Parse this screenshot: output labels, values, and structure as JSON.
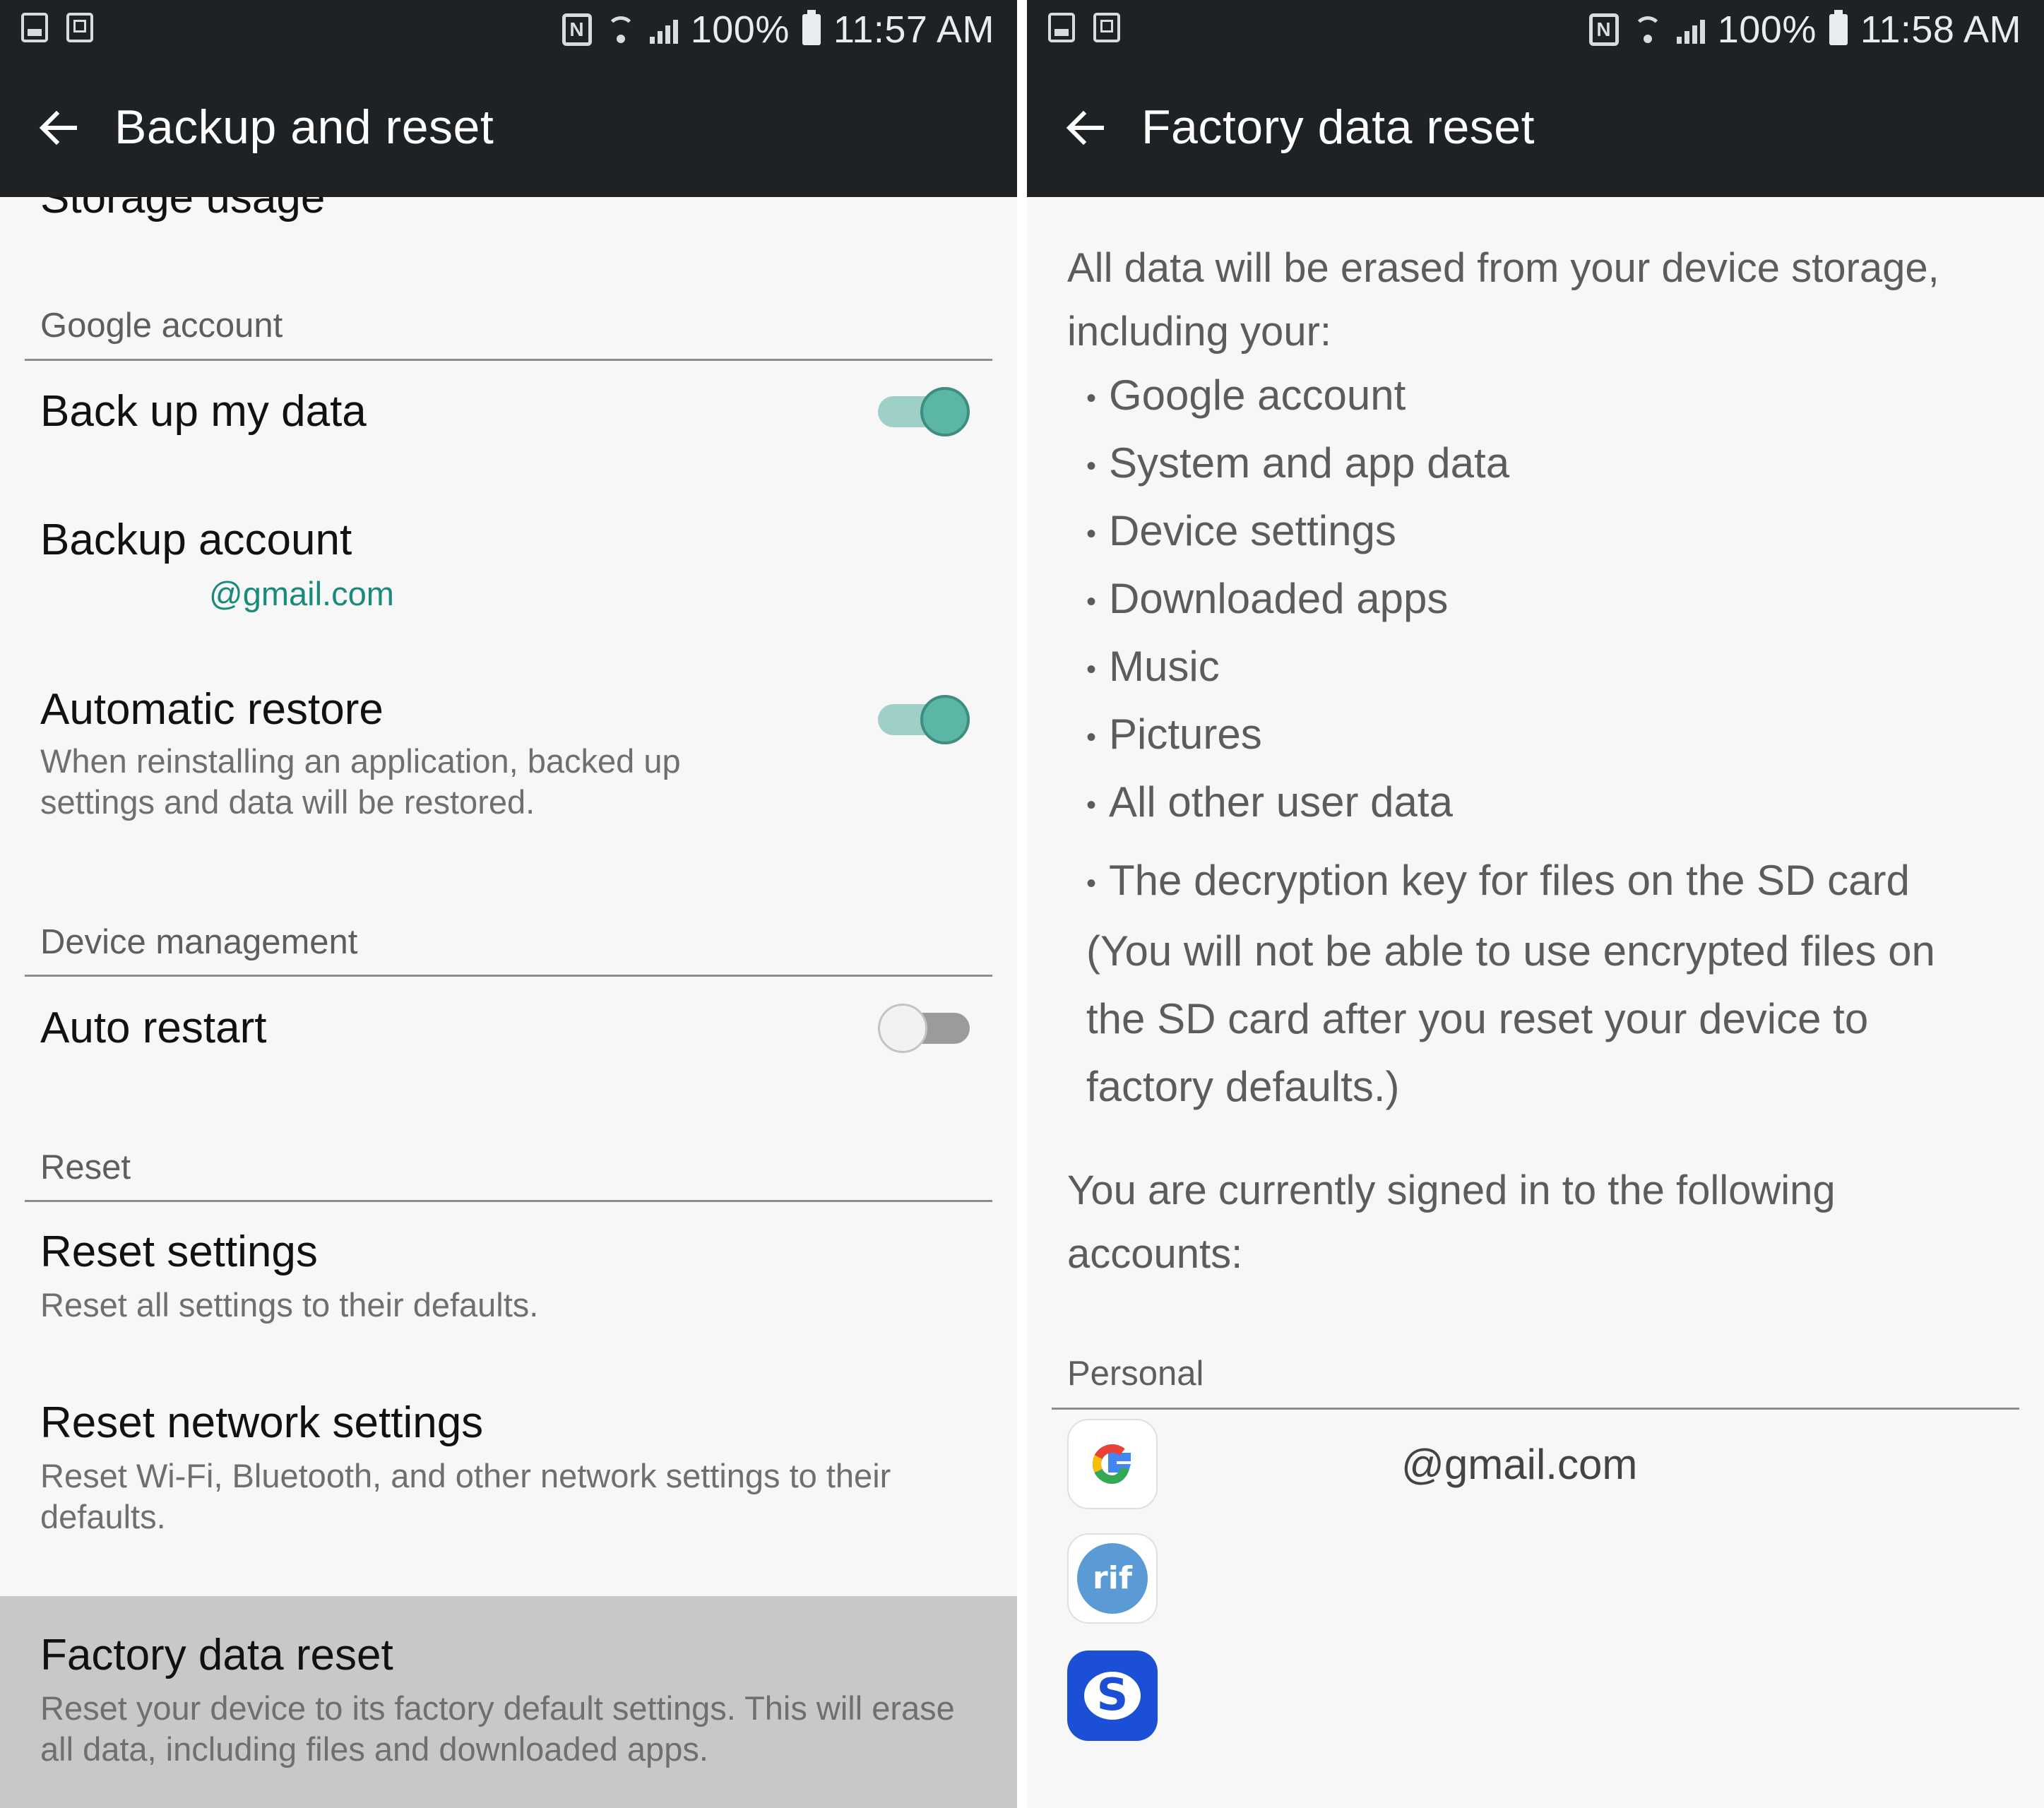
{
  "left": {
    "status": {
      "battery": "100%",
      "time": "11:57 AM"
    },
    "appbar": {
      "title": "Backup and reset"
    },
    "partial_item": "Storage usage",
    "sections": {
      "google": "Google account",
      "device": "Device management",
      "reset": "Reset"
    },
    "items": {
      "backup_data": {
        "title": "Back up my data",
        "enabled": true
      },
      "backup_account": {
        "title": "Backup account",
        "value": "@gmail.com"
      },
      "auto_restore": {
        "title": "Automatic restore",
        "subtitle": "When reinstalling an application, backed up settings and data will be restored.",
        "enabled": true
      },
      "auto_restart": {
        "title": "Auto restart",
        "enabled": false
      },
      "reset_settings": {
        "title": "Reset settings",
        "subtitle": "Reset all settings to their defaults."
      },
      "reset_network": {
        "title": "Reset network settings",
        "subtitle": "Reset Wi-Fi, Bluetooth, and other network settings to their defaults."
      },
      "factory_reset": {
        "title": "Factory data reset",
        "subtitle": "Reset your device to its factory default settings. This will erase all data, including files and downloaded apps."
      }
    }
  },
  "right": {
    "status": {
      "battery": "100%",
      "time": "11:58 AM"
    },
    "appbar": {
      "title": "Factory data reset"
    },
    "intro": "All data will be erased from your device storage, including your:",
    "bullets": [
      "Google account",
      "System and app data",
      "Device settings",
      "Downloaded apps",
      "Music",
      "Pictures",
      "All other user data"
    ],
    "sd_bullet": "The decryption key for files on the SD card (You will not be able to use encrypted files on the SD card after you reset your device to factory defaults.)",
    "signed_in": "You are currently signed in to the following accounts:",
    "section": "Personal",
    "account_email": "@gmail.com",
    "account_icons": [
      "google-icon",
      "rif-icon",
      "samsung-account-icon"
    ]
  },
  "colors": {
    "bar": "#1f2225",
    "background": "#f7f7f7",
    "accent": "#5bb6a6",
    "link": "#1a8a7b",
    "highlight": "#c8c8c8"
  }
}
